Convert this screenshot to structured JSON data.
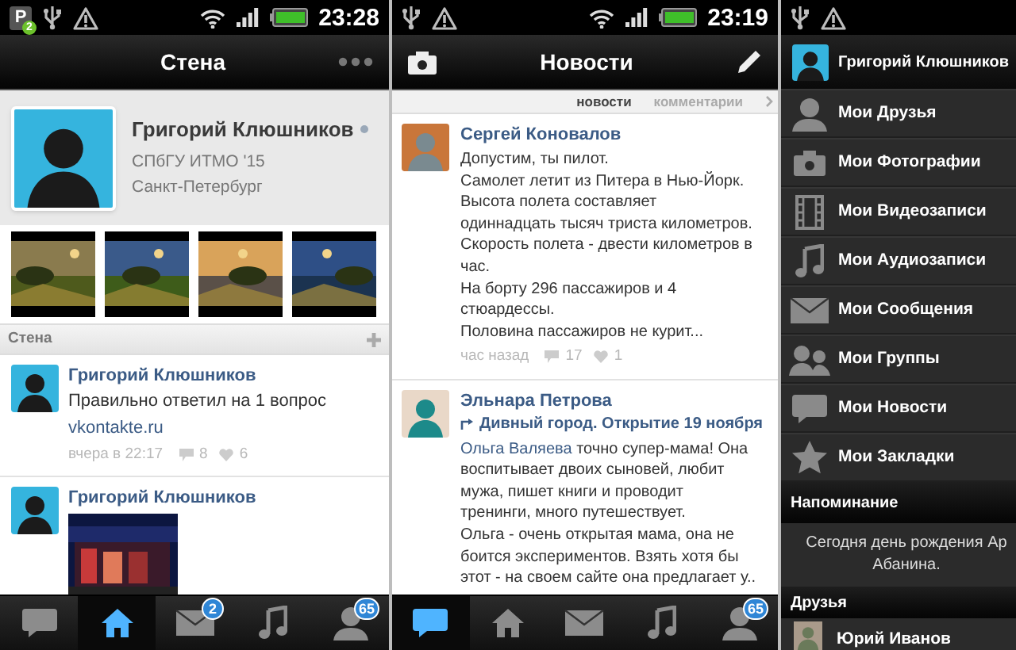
{
  "wall_screen": {
    "status_bar": {
      "app_letter": "P",
      "notification_count": "2",
      "time": "23:28"
    },
    "title": "Стена",
    "profile": {
      "name": "Григорий Клюшников",
      "online": false,
      "university": "СПбГУ ИТМО '15",
      "city": "Санкт-Петербург"
    },
    "wall_header": "Стена",
    "posts": [
      {
        "author": "Григорий Клюшников",
        "text": "Правильно ответил на 1 вопрос",
        "link": "vkontakte.ru",
        "time": "вчера в 22:17",
        "comments": "8",
        "likes": "6"
      },
      {
        "author": "Григорий Клюшников"
      }
    ],
    "tab_bar": [
      {
        "kind": "chat",
        "selected": false
      },
      {
        "kind": "home",
        "selected": true
      },
      {
        "kind": "mail",
        "selected": false,
        "badge": "2"
      },
      {
        "kind": "music",
        "selected": false
      },
      {
        "kind": "friends",
        "selected": false,
        "badge": "65"
      }
    ]
  },
  "news_screen": {
    "status_bar": {
      "time": "23:19"
    },
    "title": "Новости",
    "tabs": [
      {
        "label": "новости",
        "selected": true
      },
      {
        "label": "комментарии",
        "selected": false
      }
    ],
    "posts": [
      {
        "author": "Сергей Коновалов",
        "text": "Допустим, ты пилот.\nСамолет летит из Питера в Нью-Йорк.\nВысота полета составляет\nодиннадцать тысяч триста километров.\nСкорость полета - двести километров в\nчас.\nНа борту 296 пассажиров и 4\nстюардессы.\nПоловина пассажиров не курит...",
        "time": "час назад",
        "comments": "17",
        "likes": "1"
      },
      {
        "author": "Эльнара Петрова",
        "repost_title": "Дивный город. Открытие 19 ноября",
        "mention": "Ольга Валяева",
        "text": " точно супер-мама! Она\nвоспитывает двоих сыновей, любит\nмужа, пишет книги и проводит\nтренинги, много путешествует.\nОльга - очень открытая мама, она не\nбоится экспериментов. Взять хотя бы\nэтот - на своем сайте она предлагает у.."
      }
    ],
    "tab_bar": [
      {
        "kind": "chat",
        "selected": true
      },
      {
        "kind": "home",
        "selected": false
      },
      {
        "kind": "mail",
        "selected": false
      },
      {
        "kind": "music",
        "selected": false
      },
      {
        "kind": "friends",
        "selected": false,
        "badge": "65"
      }
    ]
  },
  "menu_screen": {
    "user_name": "Григорий Клюшников",
    "items": [
      {
        "kind": "friends",
        "label": "Мои Друзья"
      },
      {
        "kind": "photos",
        "label": "Мои Фотографии"
      },
      {
        "kind": "videos",
        "label": "Мои Видеозаписи"
      },
      {
        "kind": "music",
        "label": "Мои Аудиозаписи"
      },
      {
        "kind": "mail",
        "label": "Мои Сообщения"
      },
      {
        "kind": "groups",
        "label": "Мои Группы"
      },
      {
        "kind": "news",
        "label": "Мои Новости"
      },
      {
        "kind": "bookmarks",
        "label": "Мои Закладки"
      }
    ],
    "reminder_header": "Напоминание",
    "reminder_text": "Сегодня день рождения Ар\nАбанина.",
    "friends_header": "Друзья",
    "friends": [
      {
        "name": "Юрий Иванов"
      }
    ]
  }
}
